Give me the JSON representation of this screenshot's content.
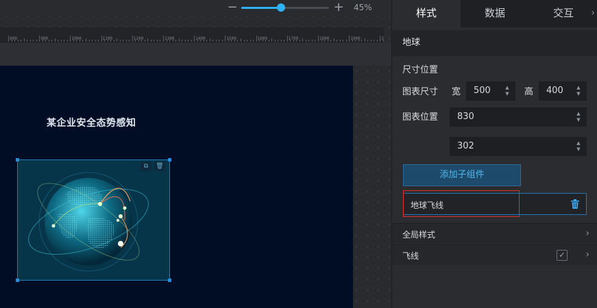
{
  "zoom": {
    "percent_label": "45%",
    "level": 0.45
  },
  "ruler": {
    "labels": [
      "800",
      "900",
      "1000",
      "1100",
      "1200",
      "1300",
      "1400",
      "1500",
      "1600",
      "1700",
      "1800",
      "1900",
      "20"
    ]
  },
  "screen": {
    "title": "某企业安全态势感知"
  },
  "tabs": [
    {
      "label": "样式",
      "active": true
    },
    {
      "label": "数据",
      "active": false
    },
    {
      "label": "交互",
      "active": false
    }
  ],
  "panel": {
    "section_title": "地球",
    "size_position_label": "尺寸位置",
    "chart_size_label": "图表尺寸",
    "width_label": "宽",
    "width_value": "500",
    "height_label": "高",
    "height_value": "400",
    "chart_position_label": "图表位置",
    "pos_x_value": "830",
    "pos_y_value": "302",
    "add_child_button": "添加子组件",
    "child_item_label": "地球飞线",
    "global_style_label": "全局样式",
    "flyline_label": "飞线",
    "flyline_checked": true
  },
  "colors": {
    "accent": "#2fb2f5",
    "screen_bg": "#010d24",
    "highlight": "#e0302b"
  },
  "icons": {
    "minus": "minus-icon",
    "plus": "plus-icon",
    "copy": "copy-icon",
    "delete": "trash-icon",
    "chevron": "chevron-right-icon",
    "check": "check-icon"
  }
}
